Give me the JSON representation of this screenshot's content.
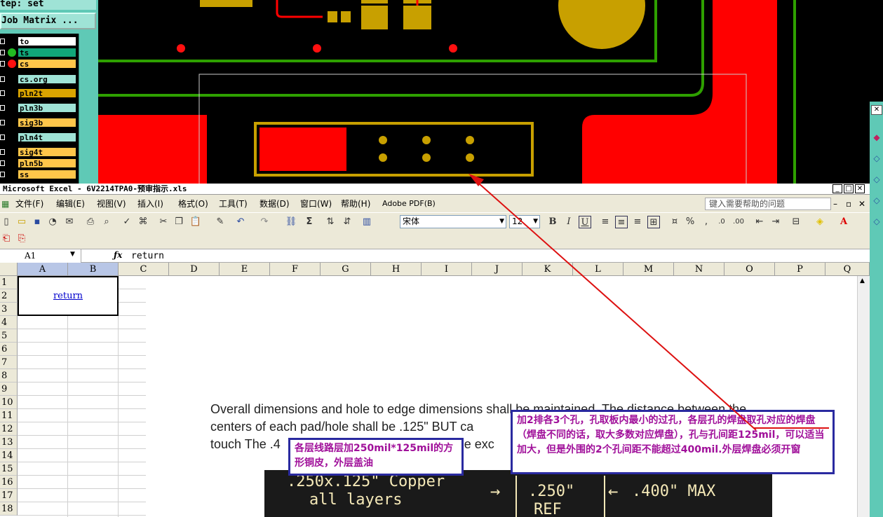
{
  "layer_panel": {
    "step_label": "tep: set",
    "job_button": "Job Matrix ...",
    "layers": [
      {
        "name": "to",
        "color": "#ffffff",
        "dot": ""
      },
      {
        "name": "ts",
        "color": "#11a67a",
        "dot": "#22bb22"
      },
      {
        "name": "cs",
        "color": "#ffc64a",
        "dot": "#ff1010"
      },
      {
        "name": "cs.org",
        "color": "#9fe3d6",
        "dot": ""
      },
      {
        "name": "pln2t",
        "color": "#d9a400",
        "dot": ""
      },
      {
        "name": "pln3b",
        "color": "#9fe3d6",
        "dot": ""
      },
      {
        "name": "sig3b",
        "color": "#ffc64a",
        "dot": ""
      },
      {
        "name": "pln4t",
        "color": "#9fe3d6",
        "dot": ""
      },
      {
        "name": "sig4t",
        "color": "#ffc64a",
        "dot": ""
      },
      {
        "name": "pln5b",
        "color": "#ffc64a",
        "dot": ""
      },
      {
        "name": "ss",
        "color": "#ffc64a",
        "dot": ""
      }
    ]
  },
  "excel": {
    "title": "Microsoft Excel - 6V2214TPA0-预审指示.xls",
    "menu": [
      "文件(F)",
      "编辑(E)",
      "视图(V)",
      "插入(I)",
      "格式(O)",
      "工具(T)",
      "数据(D)",
      "窗口(W)",
      "帮助(H)",
      "Adobe PDF(B)"
    ],
    "help_placeholder": "键入需要帮助的问题",
    "font_name": "宋体",
    "font_size": "12",
    "name_box": "A1",
    "formula_value": "return",
    "columns": [
      "A",
      "B",
      "C",
      "D",
      "E",
      "F",
      "G",
      "H",
      "I",
      "J",
      "K",
      "L",
      "M",
      "N",
      "O",
      "P",
      "Q"
    ],
    "rows": [
      "1",
      "2",
      "3",
      "4",
      "5",
      "6",
      "7",
      "8",
      "9",
      "10",
      "11",
      "12",
      "13",
      "14",
      "15",
      "16",
      "17",
      "18"
    ],
    "link_text": "return"
  },
  "document": {
    "line1": "Overall dimensions and hole to edge dimensions shall be maintained. The distance between the",
    "line2": "centers of each pad/hole shall be .125\" BUT ca",
    "line3": "touch The .4",
    "line3b": "t be exc",
    "strip_left_1": ".250x.125\" Copper",
    "strip_left_2": "all layers",
    "strip_mid_1": ".250\"",
    "strip_mid_2": "REF",
    "strip_right": ".400\" MAX"
  },
  "callouts": {
    "left": "各层线路层加250mil*125mil的方形铜皮，外层盖油",
    "right": "加2排各3个孔，孔取板内最小的过孔，各层孔的焊盘取孔对应的焊盘（焊盘不同的话，取大多数对应焊盘），孔与孔间距125mil，可以适当加大，但是外围的2个孔间距不能超过400mil.外层焊盘必须开窗"
  },
  "colors": {
    "copper": "#c8a000",
    "red_fill": "#ff0000",
    "outline_green": "#2ea000",
    "arrow": "#dd1111",
    "callout_border": "#2a2aa0",
    "callout_text": "#a0109a"
  }
}
